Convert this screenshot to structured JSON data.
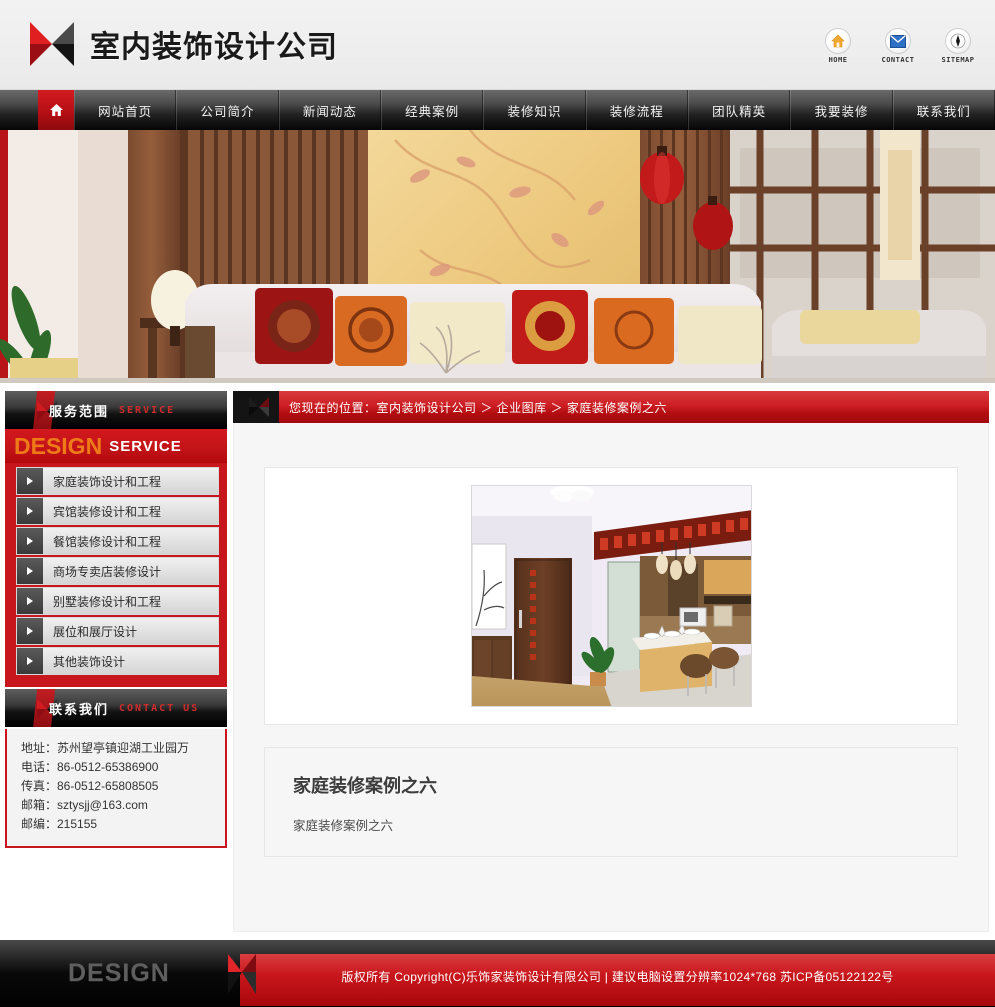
{
  "header": {
    "site_title": "室内装饰设计公司",
    "logo_icon": "diamond-logo-icon",
    "top_icons": [
      {
        "icon": "home-icon",
        "label": "HOME"
      },
      {
        "icon": "envelope-icon",
        "label": "CONTACT"
      },
      {
        "icon": "compass-icon",
        "label": "SITEMAP"
      }
    ]
  },
  "nav": {
    "home_icon": "house-icon",
    "items": [
      {
        "label": "网站首页"
      },
      {
        "label": "公司简介"
      },
      {
        "label": "新闻动态"
      },
      {
        "label": "经典案例"
      },
      {
        "label": "装修知识"
      },
      {
        "label": "装修流程"
      },
      {
        "label": "团队精英"
      },
      {
        "label": "我要装修"
      },
      {
        "label": "联系我们"
      }
    ]
  },
  "hero": {
    "alt": "中式风格客厅装修效果图 沙发 抱枕 屏风"
  },
  "sidebar": {
    "service_panel": {
      "title_cn": "服务范围",
      "title_en": "SERVICE",
      "banner_word": "DESIGN",
      "banner_sub": "SERVICE",
      "items": [
        {
          "label": "家庭装饰设计和工程",
          "icon": "arrow-right-icon"
        },
        {
          "label": "宾馆装修设计和工程",
          "icon": "arrow-right-icon"
        },
        {
          "label": "餐馆装修设计和工程",
          "icon": "arrow-right-icon"
        },
        {
          "label": "商场专卖店装修设计",
          "icon": "arrow-right-icon"
        },
        {
          "label": "别墅装修设计和工程",
          "icon": "arrow-right-icon"
        },
        {
          "label": "展位和展厅设计",
          "icon": "arrow-right-icon"
        },
        {
          "label": "其他装饰设计",
          "icon": "arrow-right-icon"
        }
      ]
    },
    "contact_panel": {
      "title_cn": "联系我们",
      "title_en": "CONTACT US",
      "lines": [
        "地址：苏州望亭镇迎湖工业园万",
        "电话：86-0512-65386900",
        "传真：86-0512-65808505",
        "邮箱：sztysjj@163.com",
        "邮编：215155"
      ]
    }
  },
  "main": {
    "breadcrumb": "您现在的位置：室内装饰设计公司  ＞ 企业图库  ＞ 家庭装修案例之六",
    "image_alt": "家庭装修案例之六 餐厅厨房装修效果图",
    "article_title": "家庭装修案例之六",
    "article_body": "家庭装修案例之六"
  },
  "footer": {
    "word": "DESIGN",
    "copyright": "版权所有  Copyright(C)乐饰家装饰设计有限公司  | 建议电脑设置分辨率1024*768 苏ICP备05122122号"
  },
  "colors": {
    "brand_red": "#c8171c",
    "brand_red_light": "#d93a3e",
    "brand_orange": "#ef7a18",
    "nav_dark": "#232323",
    "panel_bg": "#f6f6f6"
  }
}
